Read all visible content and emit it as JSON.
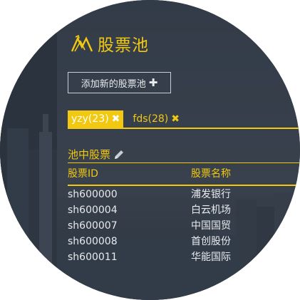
{
  "header": {
    "title": "股票池",
    "logo_icon": "stock-chart-logo-icon"
  },
  "add_button": {
    "label": "添加新的股票池",
    "icon": "plus-icon"
  },
  "tabs": [
    {
      "label": "yzy(23)",
      "active": true,
      "close_icon": "close-icon"
    },
    {
      "label": "fds(28)",
      "active": false,
      "close_icon": "close-icon"
    }
  ],
  "section": {
    "title": "池中股票",
    "edit_icon": "pencil-icon"
  },
  "table": {
    "headers": [
      "股票ID",
      "股票名称"
    ],
    "rows": [
      [
        "sh600000",
        "浦发银行"
      ],
      [
        "sh600004",
        "白云机场"
      ],
      [
        "sh600007",
        "中国国贸"
      ],
      [
        "sh600008",
        "首创股份"
      ],
      [
        "sh600011",
        "华能国际"
      ]
    ]
  },
  "colors": {
    "accent": "#f2c811",
    "background": "#37404c",
    "text": "#e8eaed"
  }
}
